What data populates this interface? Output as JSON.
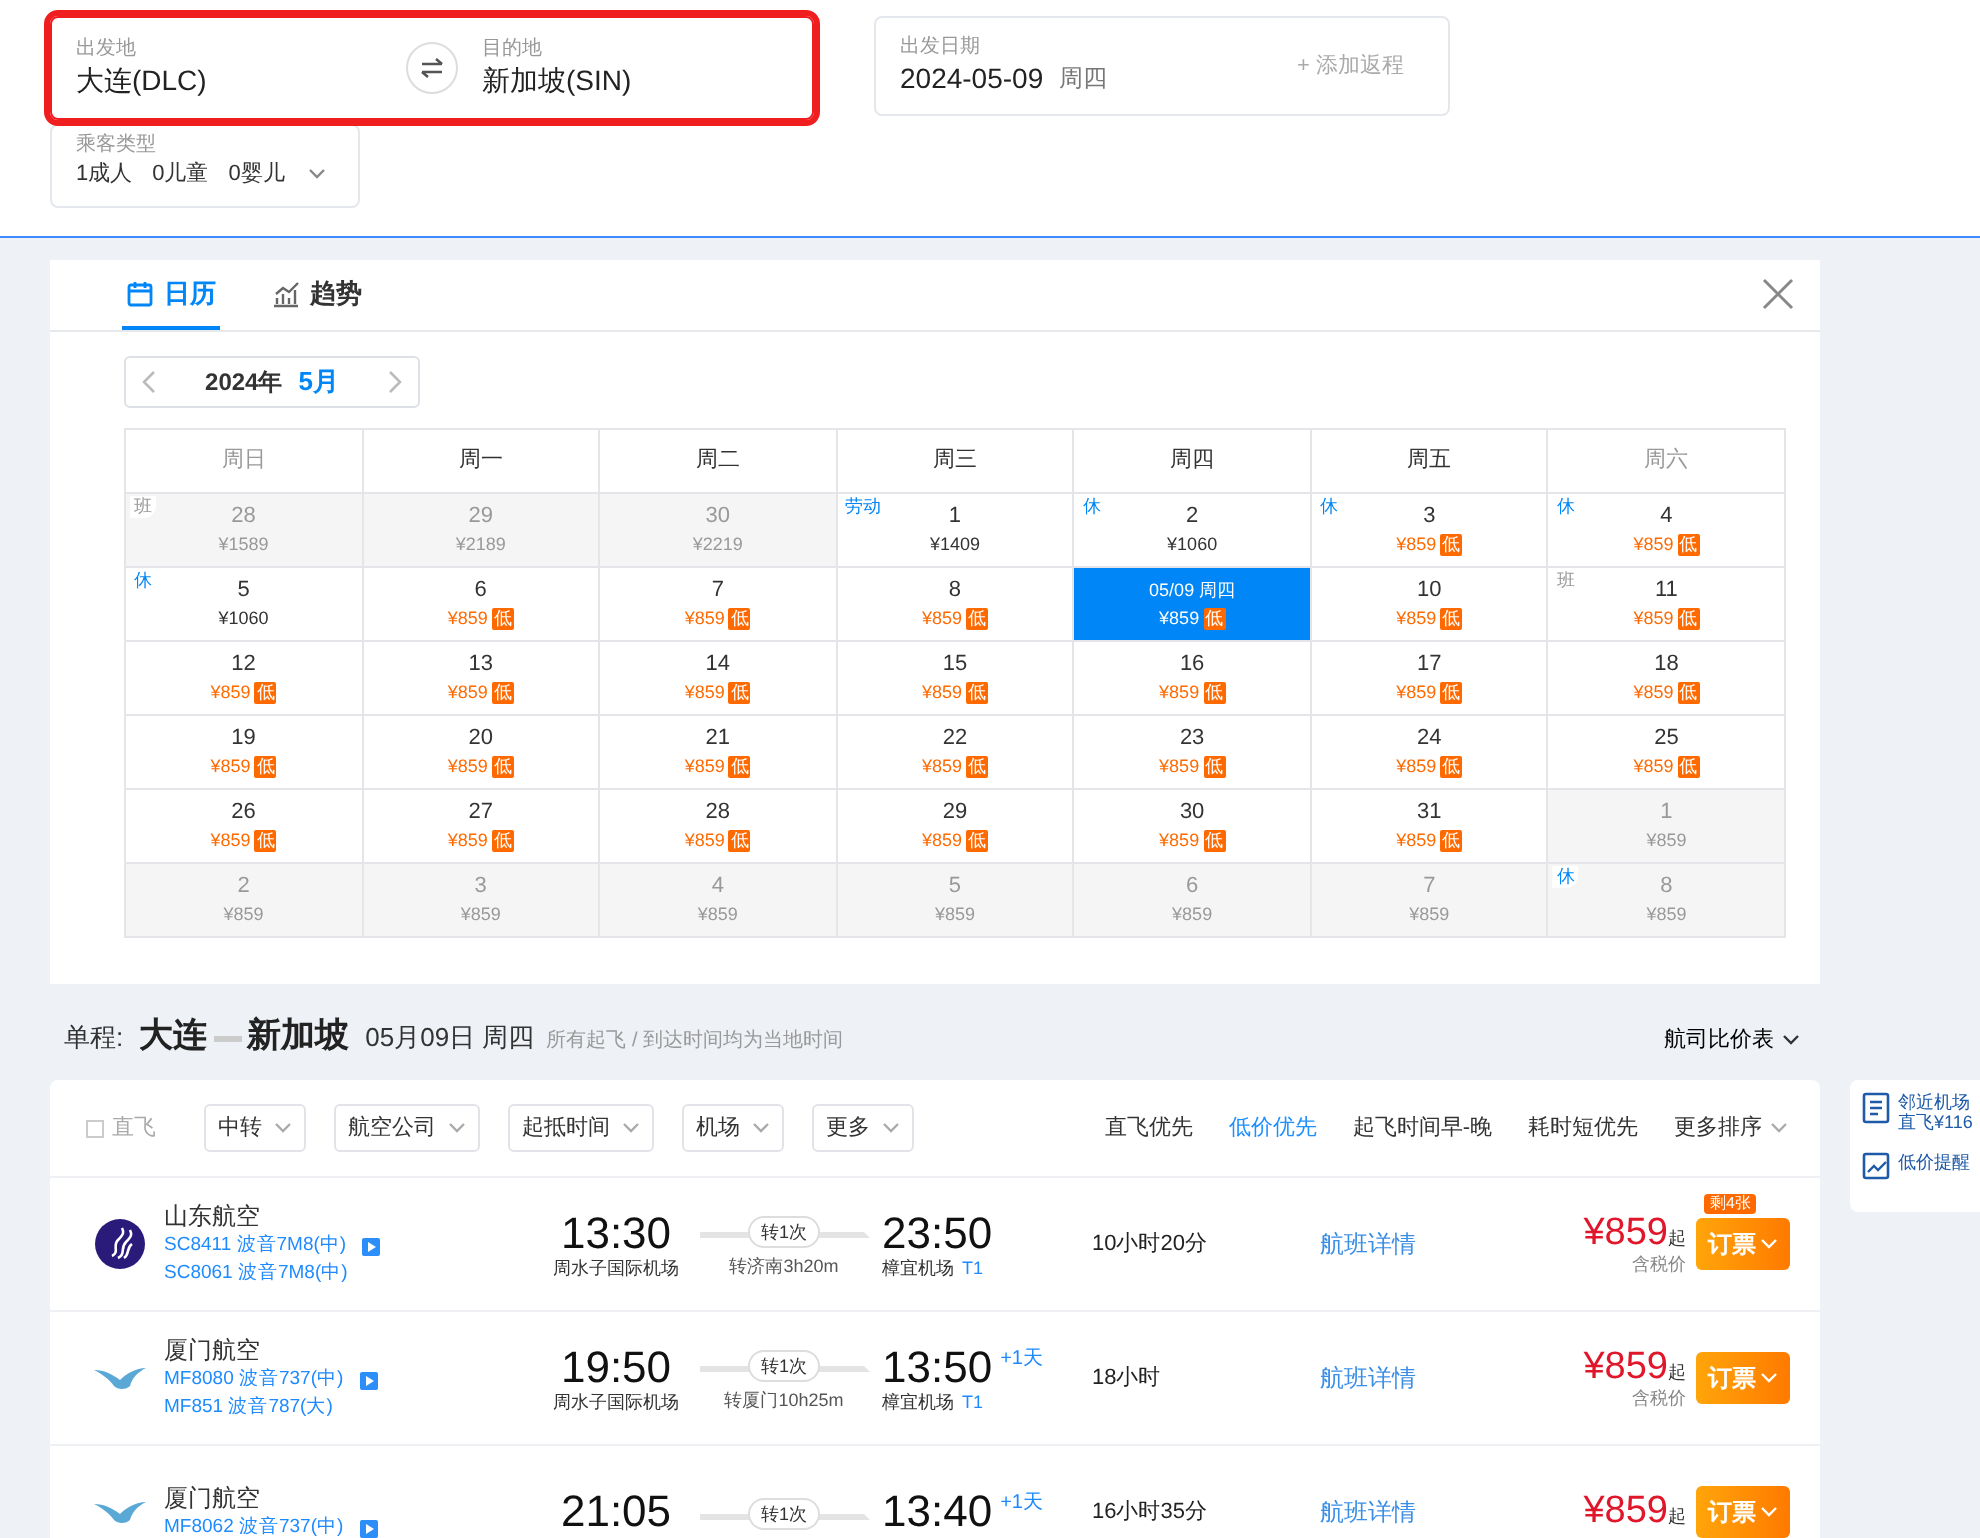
{
  "search": {
    "route": {
      "highlighted": true,
      "origin": {
        "label": "出发地",
        "value": "大连(DLC)"
      },
      "destination": {
        "label": "目的地",
        "value": "新加坡(SIN)"
      }
    },
    "date": {
      "label": "出发日期",
      "value": "2024-05-09",
      "weekday": "周四",
      "add_return": "+ 添加返程"
    },
    "passengers": {
      "label": "乘客类型",
      "values": [
        "1成人",
        "0儿童",
        "0婴儿"
      ]
    }
  },
  "calendar": {
    "tabs": [
      {
        "label": "日历",
        "kind": "calendar",
        "selected": true
      },
      {
        "label": "趋势",
        "kind": "trend",
        "selected": false
      }
    ],
    "year": "2024年",
    "month": "5月",
    "weekdays": [
      {
        "label": "周日",
        "weekend": true
      },
      {
        "label": "周一",
        "weekend": false
      },
      {
        "label": "周二",
        "weekend": false
      },
      {
        "label": "周三",
        "weekend": false
      },
      {
        "label": "周四",
        "weekend": false
      },
      {
        "label": "周五",
        "weekend": false
      },
      {
        "label": "周六",
        "weekend": true
      }
    ],
    "weeks": [
      [
        {
          "day": "28",
          "price": "¥1589",
          "muted": true,
          "selected": false,
          "tag": {
            "text": "班",
            "kind": "work"
          }
        },
        {
          "day": "29",
          "price": "¥2189",
          "muted": true,
          "selected": false
        },
        {
          "day": "30",
          "price": "¥2219",
          "muted": true,
          "selected": false
        },
        {
          "day": "1",
          "price": "¥1409",
          "muted": false,
          "selected": false,
          "tag": {
            "text": "劳动",
            "kind": "holiday"
          }
        },
        {
          "day": "2",
          "price": "¥1060",
          "muted": false,
          "selected": false,
          "tag": {
            "text": "休",
            "kind": "holiday"
          }
        },
        {
          "day": "3",
          "price": "¥859",
          "badge": "低",
          "muted": false,
          "selected": false,
          "tag": {
            "text": "休",
            "kind": "holiday"
          }
        },
        {
          "day": "4",
          "price": "¥859",
          "badge": "低",
          "muted": false,
          "selected": false,
          "tag": {
            "text": "休",
            "kind": "holiday"
          }
        }
      ],
      [
        {
          "day": "5",
          "price": "¥1060",
          "muted": false,
          "selected": false,
          "tag": {
            "text": "休",
            "kind": "holiday"
          }
        },
        {
          "day": "6",
          "price": "¥859",
          "badge": "低",
          "muted": false,
          "selected": false
        },
        {
          "day": "7",
          "price": "¥859",
          "badge": "低",
          "muted": false,
          "selected": false
        },
        {
          "day": "8",
          "price": "¥859",
          "badge": "低",
          "muted": false,
          "selected": false
        },
        {
          "day": "05/09 周四",
          "price": "¥859",
          "badge": "低",
          "muted": false,
          "selected": true
        },
        {
          "day": "10",
          "price": "¥859",
          "badge": "低",
          "muted": false,
          "selected": false
        },
        {
          "day": "11",
          "price": "¥859",
          "badge": "低",
          "muted": false,
          "selected": false,
          "tag": {
            "text": "班",
            "kind": "work"
          }
        }
      ],
      [
        {
          "day": "12",
          "price": "¥859",
          "badge": "低",
          "muted": false,
          "selected": false
        },
        {
          "day": "13",
          "price": "¥859",
          "badge": "低",
          "muted": false,
          "selected": false
        },
        {
          "day": "14",
          "price": "¥859",
          "badge": "低",
          "muted": false,
          "selected": false
        },
        {
          "day": "15",
          "price": "¥859",
          "badge": "低",
          "muted": false,
          "selected": false
        },
        {
          "day": "16",
          "price": "¥859",
          "badge": "低",
          "muted": false,
          "selected": false
        },
        {
          "day": "17",
          "price": "¥859",
          "badge": "低",
          "muted": false,
          "selected": false
        },
        {
          "day": "18",
          "price": "¥859",
          "badge": "低",
          "muted": false,
          "selected": false
        }
      ],
      [
        {
          "day": "19",
          "price": "¥859",
          "badge": "低",
          "muted": false,
          "selected": false
        },
        {
          "day": "20",
          "price": "¥859",
          "badge": "低",
          "muted": false,
          "selected": false
        },
        {
          "day": "21",
          "price": "¥859",
          "badge": "低",
          "muted": false,
          "selected": false
        },
        {
          "day": "22",
          "price": "¥859",
          "badge": "低",
          "muted": false,
          "selected": false
        },
        {
          "day": "23",
          "price": "¥859",
          "badge": "低",
          "muted": false,
          "selected": false
        },
        {
          "day": "24",
          "price": "¥859",
          "badge": "低",
          "muted": false,
          "selected": false
        },
        {
          "day": "25",
          "price": "¥859",
          "badge": "低",
          "muted": false,
          "selected": false
        }
      ],
      [
        {
          "day": "26",
          "price": "¥859",
          "badge": "低",
          "muted": false,
          "selected": false
        },
        {
          "day": "27",
          "price": "¥859",
          "badge": "低",
          "muted": false,
          "selected": false
        },
        {
          "day": "28",
          "price": "¥859",
          "badge": "低",
          "muted": false,
          "selected": false
        },
        {
          "day": "29",
          "price": "¥859",
          "badge": "低",
          "muted": false,
          "selected": false
        },
        {
          "day": "30",
          "price": "¥859",
          "badge": "低",
          "muted": false,
          "selected": false
        },
        {
          "day": "31",
          "price": "¥859",
          "badge": "低",
          "muted": false,
          "selected": false
        },
        {
          "day": "1",
          "price": "¥859",
          "muted": true,
          "selected": false
        }
      ],
      [
        {
          "day": "2",
          "price": "¥859",
          "muted": true,
          "selected": false
        },
        {
          "day": "3",
          "price": "¥859",
          "muted": true,
          "selected": false
        },
        {
          "day": "4",
          "price": "¥859",
          "muted": true,
          "selected": false
        },
        {
          "day": "5",
          "price": "¥859",
          "muted": true,
          "selected": false
        },
        {
          "day": "6",
          "price": "¥859",
          "muted": true,
          "selected": false
        },
        {
          "day": "7",
          "price": "¥859",
          "muted": true,
          "selected": false
        },
        {
          "day": "8",
          "price": "¥859",
          "muted": true,
          "selected": false,
          "tag": {
            "text": "休",
            "kind": "holiday"
          }
        }
      ]
    ]
  },
  "results": {
    "trip_type": "单程:",
    "from": "大连",
    "to": "新加坡",
    "date": "05月09日 周四",
    "note": "所有起飞 / 到达时间均为当地时间",
    "compare": "航司比价表"
  },
  "filters": {
    "direct": {
      "label": "直飞",
      "checked": false
    },
    "dropdowns": [
      "中转",
      "航空公司",
      "起抵时间",
      "机场",
      "更多"
    ],
    "sorts": [
      {
        "label": "直飞优先",
        "selected": false
      },
      {
        "label": "低价优先",
        "selected": true
      },
      {
        "label": "起飞时间早-晚",
        "selected": false
      },
      {
        "label": "耗时短优先",
        "selected": false
      },
      {
        "label": "更多排序",
        "selected": false
      }
    ]
  },
  "side_panel": [
    {
      "kind": "nearby",
      "lines": [
        "邻近机场",
        "直飞¥116"
      ]
    },
    {
      "kind": "alert",
      "lines": [
        "低价提醒"
      ]
    }
  ],
  "flights": [
    {
      "airline": "山东航空",
      "kind": "shandong",
      "legs": [
        {
          "code": "SC8411 波音7M8(中)",
          "share": true
        },
        {
          "code": "SC8061 波音7M8(中)",
          "share": false
        }
      ],
      "dep_time": "13:30",
      "dep_airport": "周水子国际机场",
      "stops": "转1次",
      "stop_info": "转济南3h20m",
      "arr_time": "23:50",
      "arr_airport": "樟宜机场",
      "terminal": "T1",
      "duration": "10小时20分",
      "details": "航班详情",
      "price": "¥859",
      "price_suffix": "起",
      "tax": "含税价",
      "book": "订票",
      "remaining": "剩4张"
    },
    {
      "airline": "厦门航空",
      "kind": "xiamen",
      "legs": [
        {
          "code": "MF8080 波音737(中)",
          "share": true
        },
        {
          "code": "MF851 波音787(大)",
          "share": false
        }
      ],
      "dep_time": "19:50",
      "dep_airport": "周水子国际机场",
      "stops": "转1次",
      "stop_info": "转厦门10h25m",
      "arr_time": "13:50",
      "next_day": "+1天",
      "arr_airport": "樟宜机场",
      "terminal": "T1",
      "duration": "18小时",
      "details": "航班详情",
      "price": "¥859",
      "price_suffix": "起",
      "tax": "含税价",
      "book": "订票"
    },
    {
      "airline": "厦门航空",
      "kind": "xiamen",
      "legs": [
        {
          "code": "MF8062 波音737(中)",
          "share": true
        }
      ],
      "dep_time": "21:05",
      "stops": "转1次",
      "arr_time": "13:40",
      "next_day": "+1天",
      "duration": "16小时35分",
      "details": "航班详情",
      "price": "¥859",
      "price_suffix": "起",
      "book": "订票"
    }
  ]
}
